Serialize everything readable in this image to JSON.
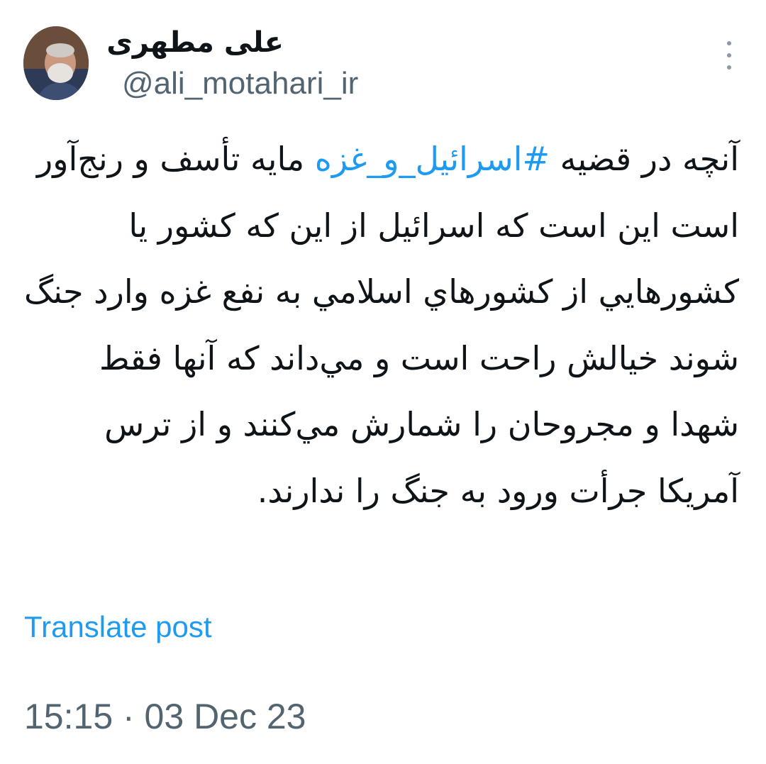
{
  "author": {
    "display_name": "علی مطهری",
    "handle": "@ali_motahari_ir"
  },
  "icons": {
    "avatar": "profile-photo",
    "more": "more-vertical-icon"
  },
  "tweet": {
    "line1_prefix": "آنچه در قضیه ",
    "hashtag": "#اسرائیل_و_غزه",
    "line1_suffix": " مایه",
    "body": "تأسف و رنج‌آور است این است که اسرائیل از این که کشور یا کشورهایي از کشورهاي اسلامي به نفع غزه وارد جنگ شوند خیالش راحت است و مي‌داند که آنها فقط شهدا و مجروحان را شمارش مي‌کنند و از ترس آمریکا جرأت ورود به جنگ را ندارند."
  },
  "translate_label": "Translate post",
  "timestamp": "15:15 · 03 Dec 23",
  "colors": {
    "link": "#1d9bf0",
    "secondary_text": "#536471",
    "primary_text": "#0f1419"
  }
}
